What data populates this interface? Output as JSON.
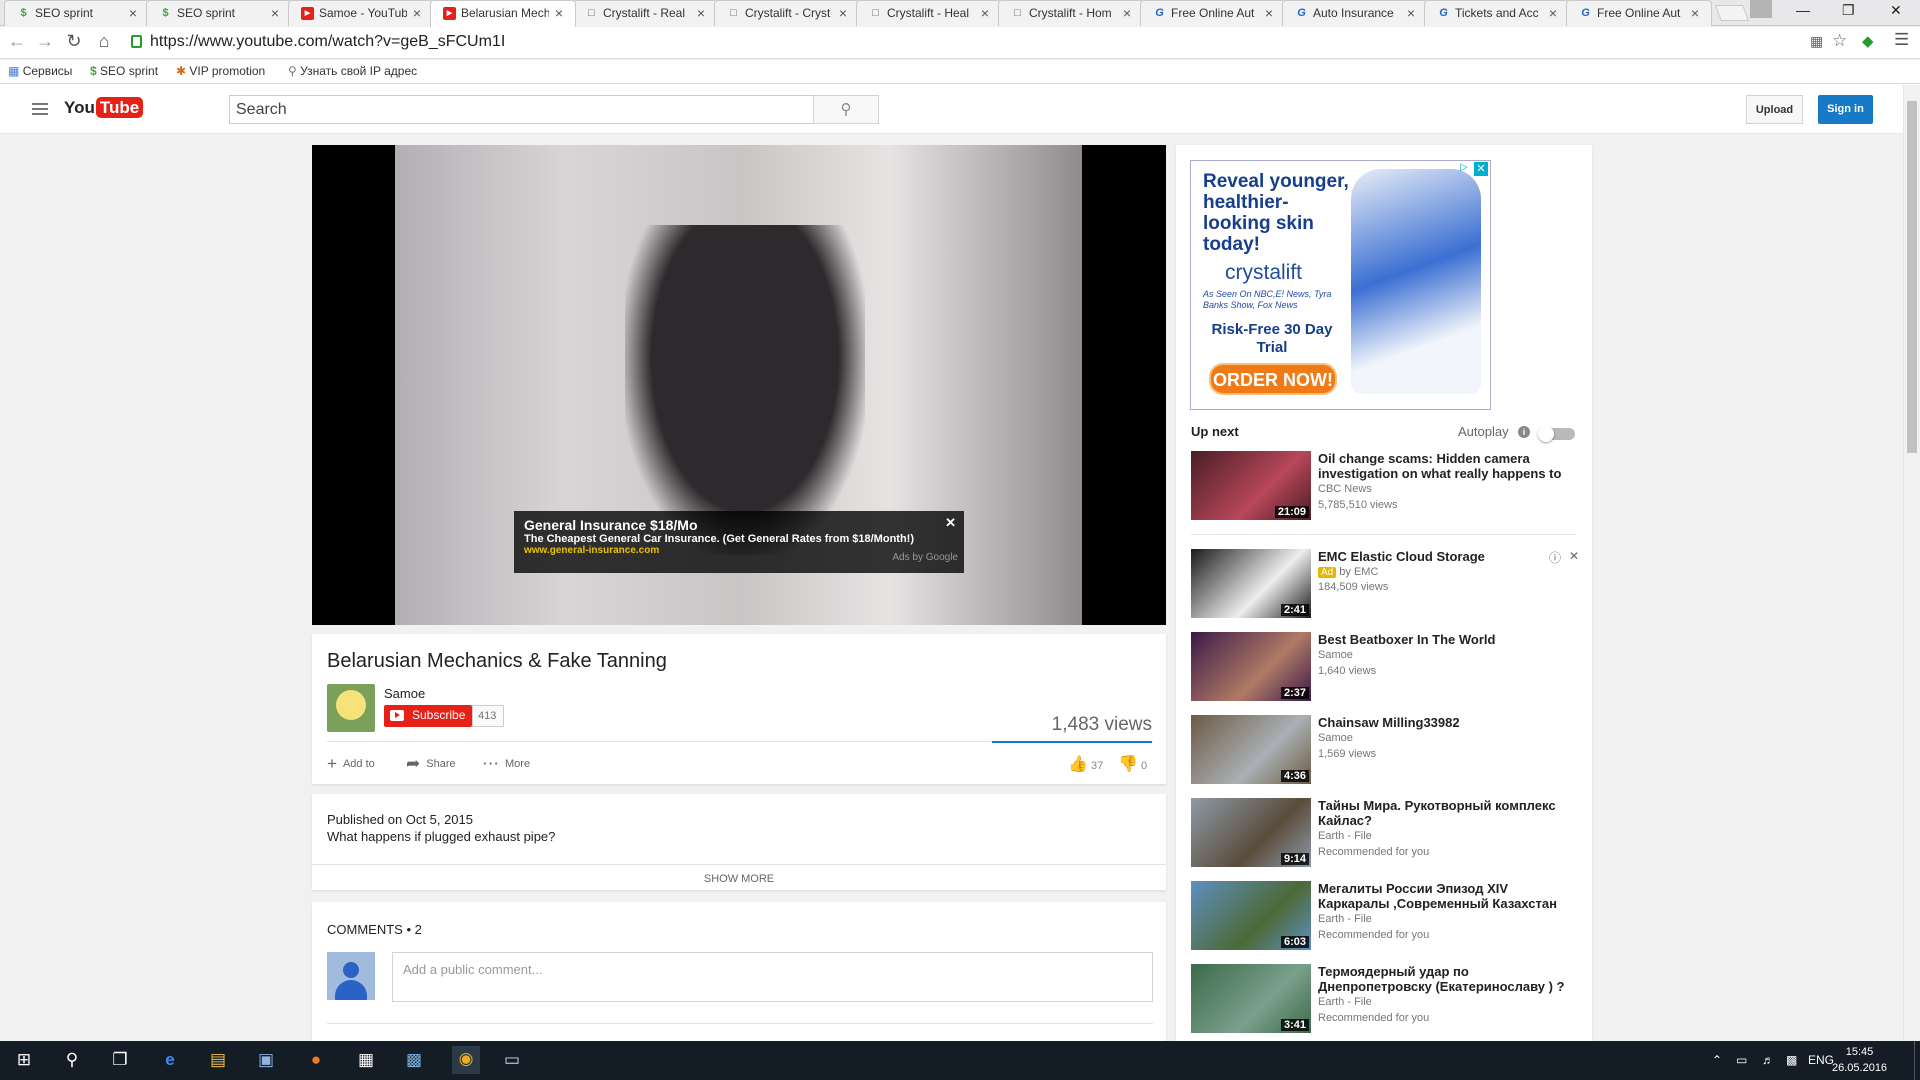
{
  "browser": {
    "tabs": [
      {
        "title": "SEO sprint",
        "icon": "dollar-icon",
        "color": "#44a244"
      },
      {
        "title": "SEO sprint",
        "icon": "dollar-icon",
        "color": "#44a244"
      },
      {
        "title": "Samoe - YouTube",
        "icon": "youtube-icon",
        "color": "#e62117"
      },
      {
        "title": "Belarusian Mech",
        "icon": "youtube-icon",
        "color": "#e62117"
      },
      {
        "title": "Crystalift - Real",
        "icon": "page-icon",
        "color": "#666666"
      },
      {
        "title": "Crystalift - Cryst",
        "icon": "page-icon",
        "color": "#666666"
      },
      {
        "title": "Crystalift - Heal",
        "icon": "page-icon",
        "color": "#666666"
      },
      {
        "title": "Crystalift - Hom",
        "icon": "page-icon",
        "color": "#666666"
      },
      {
        "title": "Free Online Aut",
        "icon": "g-icon",
        "color": "#2a62c5"
      },
      {
        "title": "Auto Insurance",
        "icon": "g-icon",
        "color": "#2a62c5"
      },
      {
        "title": "Tickets and Acc",
        "icon": "g-icon",
        "color": "#2a62c5"
      },
      {
        "title": "Free Online Aut",
        "icon": "g-icon",
        "color": "#2a62c5"
      }
    ],
    "active_tab": 3,
    "url": "https://www.youtube.com/watch?v=geB_sFCUm1I",
    "bookmarks": [
      {
        "label": "Сервисы",
        "icon": "apps-grid-icon"
      },
      {
        "label": "SEO sprint",
        "icon": "dollar-icon"
      },
      {
        "label": "VIP promotion",
        "icon": "star-badge-icon"
      },
      {
        "label": "Узнать свой IP адрес",
        "icon": "search-icon"
      }
    ]
  },
  "youtube": {
    "logo_you": "You",
    "logo_tube": "Tube",
    "search_placeholder": "Search",
    "upload_label": "Upload",
    "signin_label": "Sign in"
  },
  "video": {
    "title": "Belarusian Mechanics & Fake Tanning",
    "channel": "Samoe",
    "subscribe_label": "Subscribe",
    "subscriber_count": "413",
    "views": "1,483 views",
    "actions": {
      "add_to": "Add to",
      "share": "Share",
      "more": "More"
    },
    "likes": "37",
    "dislikes": "0",
    "published": "Published on Oct 5, 2015",
    "description": "What happens if plugged exhaust pipe?",
    "show_more": "SHOW MORE"
  },
  "overlay_ad": {
    "title": "General Insurance $18/Mo",
    "description": "The Cheapest General Car Insurance. (Get General Rates from $18/Month!)",
    "url": "www.general-insurance.com",
    "by": "Ads by Google",
    "close": "✕"
  },
  "comments": {
    "label": "COMMENTS • 2",
    "placeholder": "Add a public comment..."
  },
  "side_ad": {
    "headline": "Reveal younger, healthier-looking skin today!",
    "brand": "crystalift",
    "seen_on": "As Seen On NBC,E! News, Tyra Banks Show, Fox News",
    "offer": "Risk-Free 30 Day Trial",
    "cta": "ORDER NOW!"
  },
  "sidebar": {
    "up_next": "Up next",
    "autoplay": "Autoplay",
    "autoplay_on": false,
    "items": [
      {
        "title": "Oil change scams: Hidden camera investigation on what really happens to your",
        "channel": "CBC News",
        "meta": "5,785,510 views",
        "duration": "21:09",
        "thumb_colors": [
          "#4a1d25",
          "#b8475a"
        ]
      },
      {
        "title": "EMC Elastic Cloud Storage",
        "channel": "by EMC",
        "meta": "184,509 views",
        "duration": "2:41",
        "ad_label": "Ad",
        "thumb_colors": [
          "#1a1a1a",
          "#eeeeee"
        ]
      },
      {
        "title": "Best Beatboxer In The World",
        "channel": "Samoe",
        "meta": "1,640 views",
        "duration": "2:37",
        "thumb_colors": [
          "#3a1a4a",
          "#b07a66"
        ]
      },
      {
        "title": "Chainsaw Milling33982",
        "channel": "Samoe",
        "meta": "1,569 views",
        "duration": "4:36",
        "thumb_colors": [
          "#6c5a45",
          "#aab0b5"
        ]
      },
      {
        "title": "Тайны Мира. Рукотворный комплекс Кайлас?",
        "channel": "Earth - File",
        "meta": "Recommended for you",
        "duration": "9:14",
        "thumb_colors": [
          "#8e9aa6",
          "#5a4c3c"
        ]
      },
      {
        "title": "Мегалиты России Эпизод XIV Каркаралы ,Современный Казахстан The megaliths of",
        "channel": "Earth - File",
        "meta": "Recommended for you",
        "duration": "6:03",
        "thumb_colors": [
          "#5f8fc0",
          "#4c6a36"
        ]
      },
      {
        "title": "Термоядерный удар по Днепропетровску (Екатеринославу ) ? The unknown war",
        "channel": "Earth - File",
        "meta": "Recommended for you",
        "duration": "3:41",
        "thumb_colors": [
          "#3c6a4a",
          "#7aa08c"
        ]
      }
    ]
  },
  "taskbar": {
    "language": "ENG",
    "time": "15:45",
    "date": "26.05.2016"
  }
}
